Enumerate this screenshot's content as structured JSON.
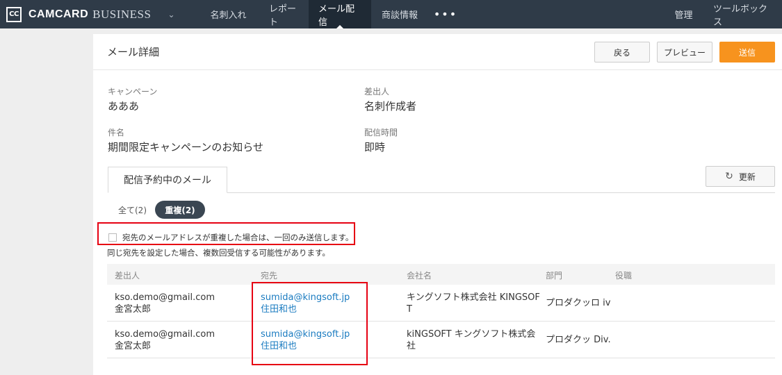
{
  "nav": {
    "logo_mark": "CC",
    "brand_bold": "CAMCARD",
    "brand_light": "BUSINESS",
    "items": [
      {
        "label": "名刺入れ"
      },
      {
        "label": "レポート"
      },
      {
        "label": "メール配信"
      },
      {
        "label": "商談情報"
      }
    ],
    "more": "•••",
    "right": [
      {
        "label": "管理"
      },
      {
        "label": "ツールボックス"
      }
    ]
  },
  "header": {
    "title": "メール詳細",
    "back": "戻る",
    "preview": "プレビュー",
    "send": "送信"
  },
  "details": {
    "campaign_label": "キャンペーン",
    "campaign_value": "あああ",
    "sender_label": "差出人",
    "sender_value": "名刺作成者",
    "subject_label": "件名",
    "subject_value": "期間限定キャンペーンのお知らせ",
    "time_label": "配信時間",
    "time_value": "即時"
  },
  "tab": {
    "label": "配信予約中のメール",
    "refresh": "更新"
  },
  "filters": {
    "all": "全て(2)",
    "duplicate": "重複(2)"
  },
  "notice": {
    "checkbox_label": "宛先のメールアドレスが重複した場合は、一回のみ送信します。",
    "note": "同じ宛先を設定した場合、複数回受信する可能性があります。"
  },
  "table": {
    "headers": [
      "差出人",
      "宛先",
      "会社名",
      "部門",
      "役職"
    ],
    "rows": [
      {
        "sender_email": "kso.demo@gmail.com",
        "sender_name": "金宮太郎",
        "to_email": "sumida@kingsoft.jp",
        "to_name": "住田和也",
        "company": "キングソフト株式会社 KINGSOFT",
        "dept": "プロダクッロ iv",
        "title": ""
      },
      {
        "sender_email": "kso.demo@gmail.com",
        "sender_name": "金宮太郎",
        "to_email": "sumida@kingsoft.jp",
        "to_name": "住田和也",
        "company": "kiNGSOFT キングソフト株式会社",
        "dept": "プロダクッ Div.",
        "title": ""
      }
    ]
  },
  "colors": {
    "nav_bg": "#2f3b48",
    "send_button": "#f7931e",
    "link": "#1a7bc0",
    "highlight_border": "#e60012"
  }
}
